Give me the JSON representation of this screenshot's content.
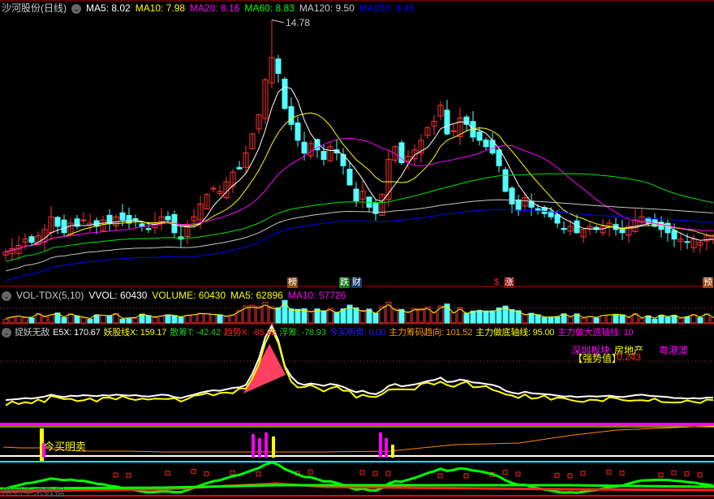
{
  "main_header": {
    "title": "沙河股份(日线)",
    "ma5": "MA5: 8.02",
    "ma10": "MA10: 7.98",
    "ma20": "MA20: 8.16",
    "ma60": "MA60: 8.83",
    "ma120": "MA120: 9.50",
    "ma250": "MA250: 8.45",
    "high_label": "14.78"
  },
  "event_tags": [
    {
      "text": "榜",
      "color": "#8a4a10"
    },
    {
      "text": "跌",
      "color": "#1a7a1a"
    },
    {
      "text": "财",
      "color": "#163a6a"
    },
    {
      "text": "$",
      "color": "#000000"
    },
    {
      "text": "涨",
      "color": "#8a1010"
    },
    {
      "text": "预",
      "color": "#a04a10"
    }
  ],
  "vol_header": {
    "name": "VOL-TDX(5,10)",
    "vvol": "VVOL: 60430",
    "volume": "VOLUME: 60430",
    "ma5": "MA5: 62896",
    "ma10": "MA10: 57726"
  },
  "ind_header": {
    "name": "捉妖无敌",
    "e5x": "E5X: 170.67",
    "yao": "妖股线X: 159.17",
    "san": "散筹T: -42.42",
    "trend": "趋势X: -85.62",
    "fu": "浮筹: -78.93",
    "jm": "今买明卖: 0.00",
    "zl": "主力筹码趋向: 101.52",
    "zd": "主力做底轴线: 95.00",
    "zdd": "主力做大底轴线: 10"
  },
  "ind_labels": {
    "sector": "深圳板块",
    "industry": "房地产",
    "region": "粤港澳",
    "strength_label": "【强势值】",
    "strength_value": "0.243",
    "jmmm": "今买明卖",
    "watermark": "用到手求数据"
  },
  "colors": {
    "up": "#ff3232",
    "down": "#54ffff",
    "ma5": "#ffffff",
    "ma10": "#ffff00",
    "ma20": "#ff00ff",
    "ma60": "#00e600",
    "ma120": "#c8c8c8",
    "ma250": "#0000ff"
  },
  "chart_data": {
    "type": "candlestick",
    "title": "沙河股份(日线)",
    "close": [
      7.5,
      7.6,
      7.7,
      7.9,
      7.8,
      8.0,
      8.2,
      8.6,
      8.3,
      8.1,
      8.4,
      8.3,
      8.5,
      8.4,
      8.3,
      8.5,
      8.4,
      8.6,
      8.5,
      8.4,
      8.5,
      8.3,
      8.2,
      8.4,
      8.6,
      8.5,
      8.1,
      7.9,
      8.3,
      8.6,
      9.0,
      9.3,
      9.5,
      9.4,
      9.7,
      10.0,
      10.1,
      10.6,
      11.2,
      11.8,
      12.9,
      13.6,
      13.1,
      12.0,
      11.5,
      11.0,
      10.6,
      10.9,
      10.7,
      10.4,
      10.8,
      10.6,
      10.2,
      9.6,
      9.1,
      9.4,
      8.9,
      8.7,
      9.3,
      10.4,
      10.8,
      10.3,
      10.5,
      10.7,
      11.0,
      11.4,
      11.6,
      12.1,
      11.2,
      11.3,
      11.7,
      11.5,
      11.1,
      11.0,
      10.8,
      10.6,
      10.2,
      9.4,
      9.0,
      8.8,
      9.2,
      8.9,
      8.8,
      8.7,
      8.6,
      8.4,
      8.2,
      8.3,
      8.1,
      8.2,
      8.3,
      8.2,
      8.3,
      8.4,
      8.2,
      8.1,
      8.3,
      8.5,
      8.6,
      8.4,
      8.3,
      8.2,
      8.1,
      7.9,
      7.9,
      7.8,
      7.9,
      7.8,
      8.0,
      8.0
    ],
    "high_price": 14.78,
    "ylim": [
      7.0,
      15.2
    ]
  }
}
